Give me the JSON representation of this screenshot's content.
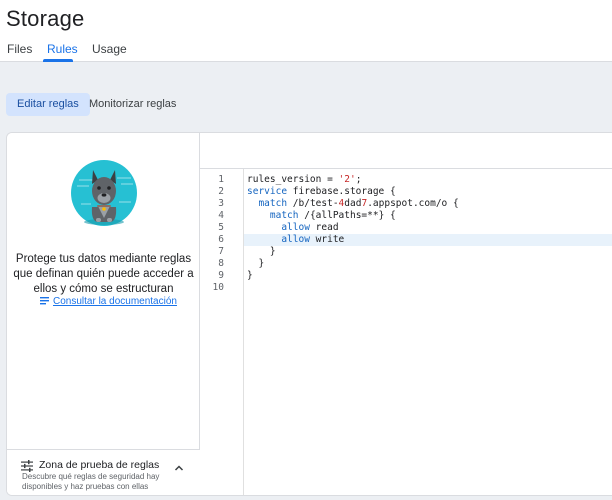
{
  "header": {
    "title": "Storage",
    "tabs": [
      {
        "label": "Files"
      },
      {
        "label": "Rules"
      },
      {
        "label": "Usage"
      }
    ],
    "active_tab": "Rules"
  },
  "subtabs": {
    "edit_label": "Editar reglas",
    "monitor_label": "Monitorizar reglas"
  },
  "left_panel": {
    "description": "Protege tus datos mediante reglas que definan quién puede acceder a ellos y cómo se estructuran",
    "doc_link": "Consultar la documentación",
    "zone": {
      "title": "Zona de prueba de reglas",
      "subtitle": "Descubre qué reglas de seguridad hay disponibles y haz pruebas con ellas"
    }
  },
  "editor": {
    "line_numbers": [
      "1",
      "2",
      "3",
      "4",
      "5",
      "6",
      "7",
      "8",
      "9",
      "10"
    ],
    "highlighted_line": 6,
    "lines": [
      {
        "t1": "rules_version = ",
        "s1": "'2'",
        "t2": ";"
      },
      {
        "k1": "service",
        "t1": " firebase.storage {"
      },
      {
        "t0": "  ",
        "k1": "match",
        "t1": " /b/test-",
        "s1": "4",
        "t2": "dad",
        "s2": "7",
        "t3": ".appspot.com/o {"
      },
      {
        "t0": "    ",
        "k1": "match",
        "t1": " /{allPaths=**} {"
      },
      {
        "t0": "      ",
        "k1": "allow",
        "t1": " read"
      },
      {
        "t0": "      ",
        "k1": "allow",
        "t1": " write"
      },
      {
        "t0": "    }"
      },
      {
        "t0": "  }"
      },
      {
        "t0": "}"
      },
      {
        "t0": ""
      }
    ]
  },
  "colors": {
    "accent": "#1a73e8",
    "mascot_circle": "#26c0d3",
    "keyword": "#1565c0",
    "string": "#c62828"
  }
}
